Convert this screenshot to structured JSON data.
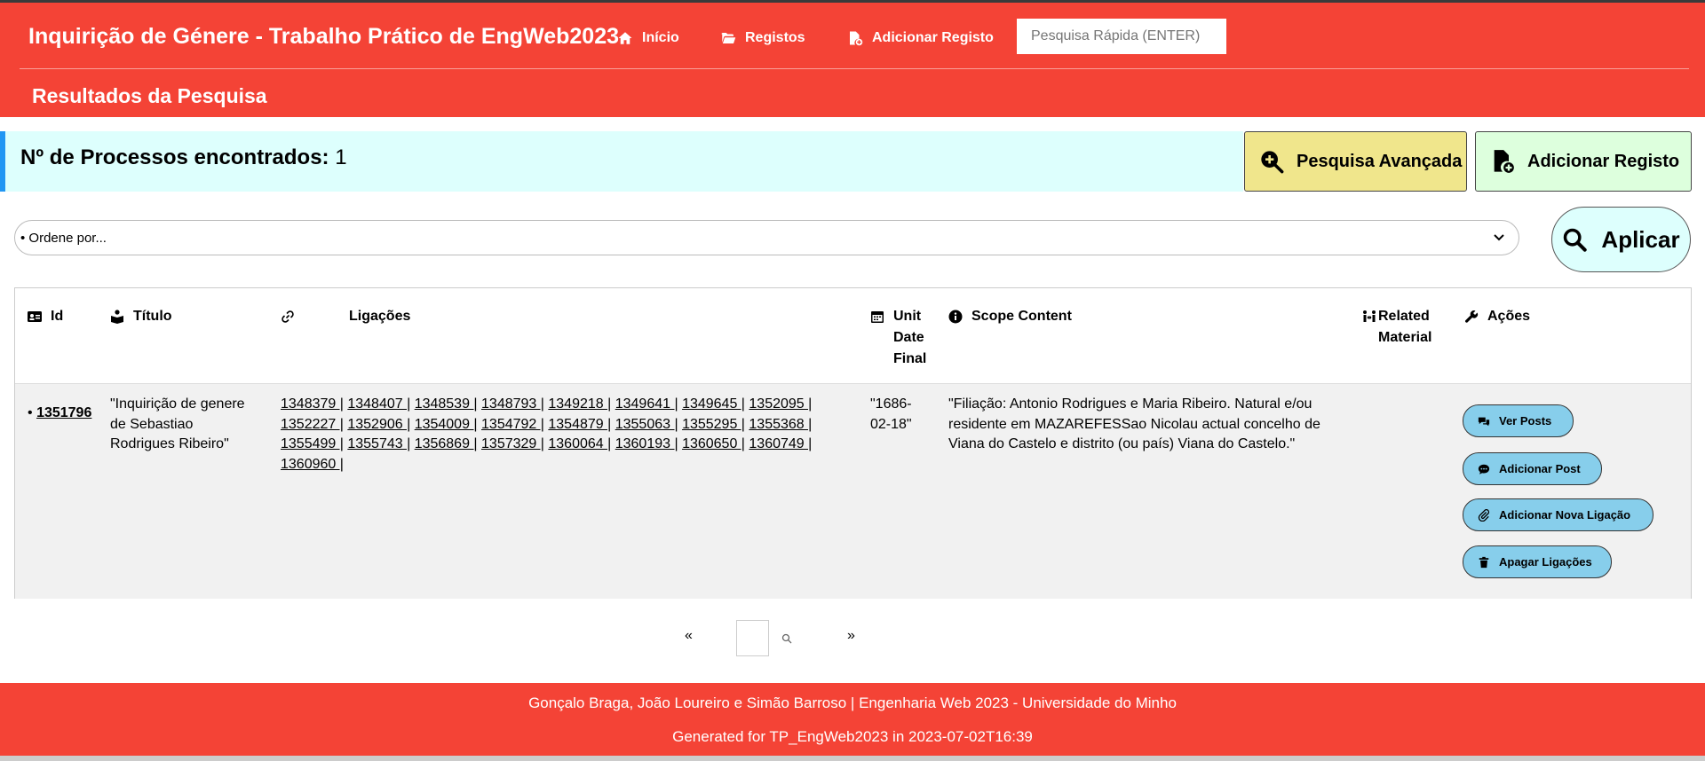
{
  "header": {
    "title": "Inquirição de Génere - Trabalho Prático de EngWeb2023",
    "nav": [
      {
        "label": "Início",
        "icon": "home-icon"
      },
      {
        "label": "Registos",
        "icon": "folder-open-icon"
      },
      {
        "label": "Adicionar Registo",
        "icon": "file-add-icon"
      }
    ],
    "quick_search_placeholder": "Pesquisa Rápida (ENTER)",
    "page_title": "Resultados da Pesquisa"
  },
  "summary": {
    "label": "Nº de Processos encontrados:",
    "count": "1"
  },
  "buttons": {
    "advanced_search": "Pesquisa Avançada",
    "add_record": "Adicionar Registo",
    "apply": "Aplicar"
  },
  "sort": {
    "selected": "• Ordene por..."
  },
  "table": {
    "columns": [
      {
        "label": "Id",
        "icon": "id-card-icon"
      },
      {
        "label": "Título",
        "icon": "book-reader-icon"
      },
      {
        "label": "",
        "icon": "link-icon"
      },
      {
        "label": "Ligações",
        "icon": ""
      },
      {
        "label": "Unit Date Final",
        "icon": "calendar-icon"
      },
      {
        "label": "Scope Content",
        "icon": "info-circle-icon"
      },
      {
        "label": "Related Material",
        "icon": "people-arrows-icon"
      },
      {
        "label": "Ações",
        "icon": "wrench-icon"
      }
    ],
    "rows": [
      {
        "bullet": "•",
        "id": "1351796",
        "title": "\"Inquirição de genere de Sebastiao Rodrigues Ribeiro\"",
        "links": [
          "1348379",
          "1348407",
          "1348539",
          "1348793",
          "1349218",
          "1349641",
          "1349645",
          "1352095",
          "1352227",
          "1352906",
          "1354009",
          "1354792",
          "1354879",
          "1355063",
          "1355295",
          "1355368",
          "1355499",
          "1355743",
          "1356869",
          "1357329",
          "1360064",
          "1360193",
          "1360650",
          "1360749",
          "1360960"
        ],
        "unit_date_final": "\"1686-02-18\"",
        "scope_content": "\"Filiação: Antonio Rodrigues e Maria Ribeiro. Natural e/ou residente em MAZAREFESSao Nicolau actual concelho de Viana do Castelo e distrito (ou país) Viana do Castelo.\"",
        "related_material": "",
        "actions": [
          "Ver Posts",
          "Adicionar Post",
          "Adicionar Nova Ligação",
          "Apagar Ligações"
        ]
      }
    ]
  },
  "pagination": {
    "prev": "«",
    "next": "»",
    "page_value": ""
  },
  "footer": {
    "line1": "Gonçalo Braga, João Loureiro e Simão Barroso | Engenharia Web 2023 - Universidade do Minho",
    "line2": "Generated for TP_EngWeb2023 in 2023-07-02T16:39"
  },
  "colors": {
    "primary_red": "#f44336",
    "info_cyan": "#ddfffd",
    "info_border_blue": "#2196f3",
    "khaki": "#f0e68c",
    "light_green": "#ddffdd",
    "sky_blue": "#87ceeb",
    "row_gray": "#f1f1f1"
  }
}
